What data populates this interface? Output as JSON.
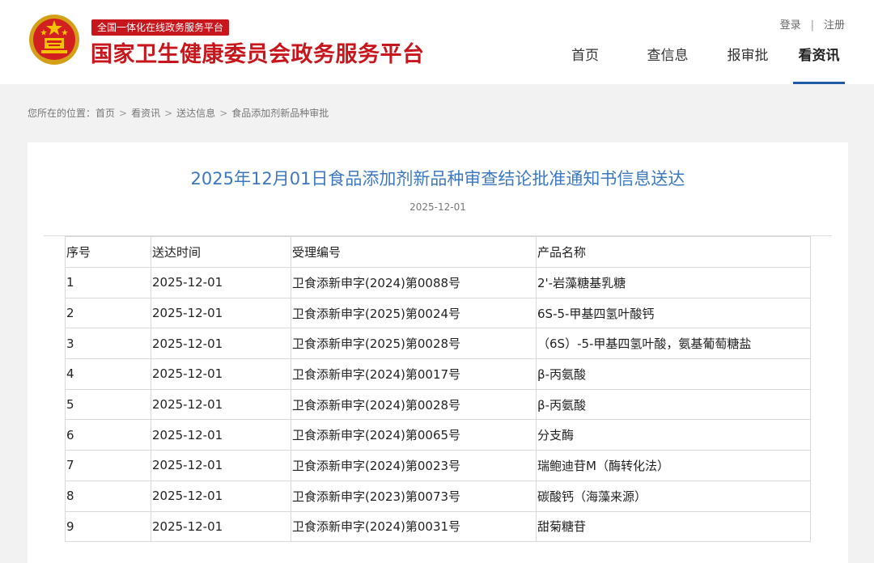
{
  "header": {
    "platform_tag": "全国一体化在线政务服务平台",
    "site_title": "国家卫生健康委员会政务服务平台",
    "login": "登录",
    "separator": "|",
    "register": "注册",
    "nav": [
      {
        "label": "首页",
        "active": false
      },
      {
        "label": "查信息",
        "active": false
      },
      {
        "label": "报审批",
        "active": false
      },
      {
        "label": "看资讯",
        "active": true
      }
    ]
  },
  "breadcrumb": {
    "prefix": "您所在的位置：",
    "items": [
      "首页",
      "看资讯",
      "送达信息",
      "食品添加剂新品种审批"
    ],
    "arrow": ">"
  },
  "article": {
    "title": "2025年12月01日食品添加剂新品种审查结论批准通知书信息送达",
    "date": "2025-12-01"
  },
  "table": {
    "headers": [
      "序号",
      "送达时间",
      "受理编号",
      "产品名称"
    ],
    "rows": [
      [
        "1",
        "2025-12-01",
        "卫食添新申字(2024)第0088号",
        "2'-岩藻糖基乳糖"
      ],
      [
        "2",
        "2025-12-01",
        "卫食添新申字(2025)第0024号",
        "6S-5-甲基四氢叶酸钙"
      ],
      [
        "3",
        "2025-12-01",
        "卫食添新申字(2025)第0028号",
        "（6S）-5-甲基四氢叶酸，氨基葡萄糖盐"
      ],
      [
        "4",
        "2025-12-01",
        "卫食添新申字(2024)第0017号",
        "β-丙氨酸"
      ],
      [
        "5",
        "2025-12-01",
        "卫食添新申字(2024)第0028号",
        "β-丙氨酸"
      ],
      [
        "6",
        "2025-12-01",
        "卫食添新申字(2024)第0065号",
        "分支酶"
      ],
      [
        "7",
        "2025-12-01",
        "卫食添新申字(2024)第0023号",
        "瑞鲍迪苷M（酶转化法）"
      ],
      [
        "8",
        "2025-12-01",
        "卫食添新申字(2023)第0073号",
        "碳酸钙（海藻来源）"
      ],
      [
        "9",
        "2025-12-01",
        "卫食添新申字(2024)第0031号",
        "甜菊糖苷"
      ]
    ]
  },
  "colors": {
    "brand_red": "#c8161d",
    "title_blue": "#3c78c0",
    "nav_active_underline": "#1f5aa6"
  },
  "icons": {
    "emblem": "national-emblem-icon"
  }
}
